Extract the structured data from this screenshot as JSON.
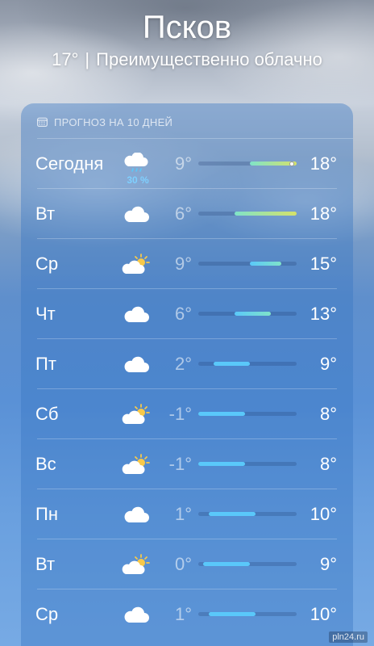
{
  "header": {
    "city": "Псков",
    "current_temp": "17°",
    "separator": "|",
    "condition": "Преимущественно облачно"
  },
  "forecast": {
    "title": "ПРОГНОЗ НА 10 ДНЕЙ",
    "icon": "calendar-icon",
    "range": {
      "min": -1,
      "max": 18
    },
    "current_temp_value": 17,
    "days": [
      {
        "day": "Сегодня",
        "icon": "cloud-rain-icon",
        "precip": "30 %",
        "low": "9°",
        "high": "18°",
        "low_value": 9,
        "high_value": 18,
        "show_current": true
      },
      {
        "day": "Вт",
        "icon": "cloud-icon",
        "precip": "",
        "low": "6°",
        "high": "18°",
        "low_value": 6,
        "high_value": 18,
        "show_current": false
      },
      {
        "day": "Ср",
        "icon": "cloud-sun-icon",
        "precip": "",
        "low": "9°",
        "high": "15°",
        "low_value": 9,
        "high_value": 15,
        "show_current": false
      },
      {
        "day": "Чт",
        "icon": "cloud-icon",
        "precip": "",
        "low": "6°",
        "high": "13°",
        "low_value": 6,
        "high_value": 13,
        "show_current": false
      },
      {
        "day": "Пт",
        "icon": "cloud-icon",
        "precip": "",
        "low": "2°",
        "high": "9°",
        "low_value": 2,
        "high_value": 9,
        "show_current": false
      },
      {
        "day": "Сб",
        "icon": "cloud-sun-icon",
        "precip": "",
        "low": "-1°",
        "high": "8°",
        "low_value": -1,
        "high_value": 8,
        "show_current": false
      },
      {
        "day": "Вс",
        "icon": "cloud-sun-icon",
        "precip": "",
        "low": "-1°",
        "high": "8°",
        "low_value": -1,
        "high_value": 8,
        "show_current": false
      },
      {
        "day": "Пн",
        "icon": "cloud-icon",
        "precip": "",
        "low": "1°",
        "high": "10°",
        "low_value": 1,
        "high_value": 10,
        "show_current": false
      },
      {
        "day": "Вт",
        "icon": "cloud-sun-icon",
        "precip": "",
        "low": "0°",
        "high": "9°",
        "low_value": 0,
        "high_value": 9,
        "show_current": false
      },
      {
        "day": "Ср",
        "icon": "cloud-icon",
        "precip": "",
        "low": "1°",
        "high": "10°",
        "low_value": 1,
        "high_value": 10,
        "show_current": false
      }
    ]
  },
  "colors": {
    "cold": "#5ac8fa",
    "mild": "#7fe3c9",
    "warm": "#d6e26a",
    "precip": "#7fd0ff"
  },
  "watermark": "pln24.ru"
}
